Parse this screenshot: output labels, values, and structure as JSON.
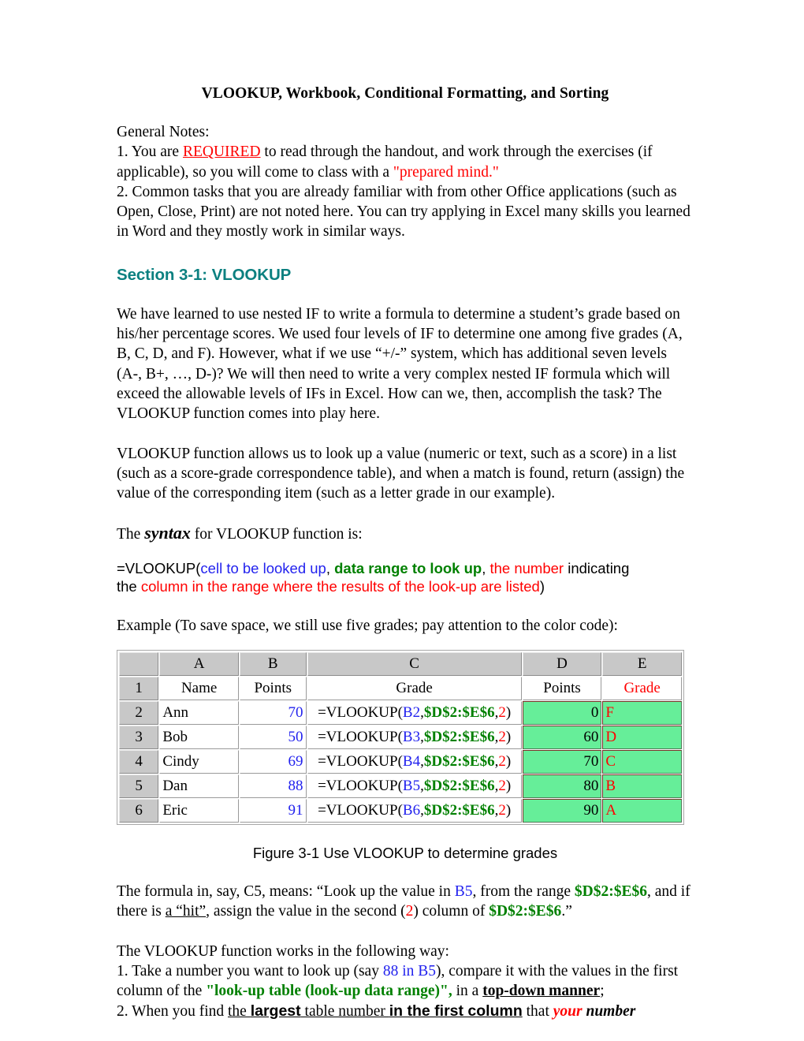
{
  "document": {
    "title": "VLOOKUP, Workbook, Conditional Formatting, and Sorting"
  },
  "general_notes": {
    "label": "General Notes:",
    "item1": {
      "lead": "1. You are ",
      "required": "REQUIRED",
      "mid": " to read through the handout, and work through the exercises (if applicable), so you will come to class with a ",
      "quote": "\"prepared mind.\""
    },
    "item2": "2. Common tasks that you are already familiar with from other Office applications (such as Open, Close, Print) are not noted here. You can try applying in Excel many skills you learned in Word and they mostly work in similar ways."
  },
  "section": {
    "heading": "Section 3-1: VLOOKUP",
    "heading_color": "#0c8080",
    "para1": "We have learned to use nested IF to write a formula to determine a student’s grade based on his/her percentage scores. We used four levels of IF to determine one among five grades (A, B, C, D, and F). However, what if we use “+/-” system, which has additional seven levels (A-, B+, …, D-)? We will then need to write a very complex nested IF formula which will exceed the allowable levels of IFs in Excel. How can we, then, accomplish the task? The VLOOKUP function comes into play here.",
    "para2": "VLOOKUP function allows us to look up a value (numeric or text, such as a score) in a list (such as a score-grade correspondence table), and when a match is found, return (assign) the value of the corresponding item (such as a letter grade in our example).",
    "syntax_intro": {
      "before": "The ",
      "word": "syntax",
      "after": " for VLOOKUP function is:"
    }
  },
  "syntax": {
    "p1_black": "=VLOOKUP(",
    "p1_blue": "cell to be looked up",
    "p1_sep1": ", ",
    "p1_green": "data range to look up",
    "p1_sep2": ", ",
    "p1_red": "the number",
    "p1_black2": " indicating",
    "p2_black": "the ",
    "p2_red": "column in the range where the results of the look-up are listed",
    "p2_close": ")"
  },
  "example_intro": "Example (To save space, we still use five grades; pay attention to the color code):",
  "spreadsheet": {
    "column_headers": [
      "",
      "A",
      "B",
      "C",
      "D",
      "E"
    ],
    "row_numbers": [
      "1",
      "2",
      "3",
      "4",
      "5",
      "6"
    ],
    "row1": {
      "A": "Name",
      "B": "Points",
      "C": "Grade",
      "D": "Points",
      "E": "Grade"
    },
    "rows": [
      {
        "n": "2",
        "name": "Ann",
        "points": "70",
        "formula_pre": "=VLOOKUP(",
        "formula_cell": "B2",
        "formula_comma1": ",",
        "formula_range": "$D$2:$E$6",
        "formula_comma2": ",",
        "formula_index": "2",
        "formula_post": ")",
        "table_points": "0",
        "table_grade": "F"
      },
      {
        "n": "3",
        "name": "Bob",
        "points": "50",
        "formula_pre": "=VLOOKUP(",
        "formula_cell": "B3",
        "formula_comma1": ",",
        "formula_range": "$D$2:$E$6",
        "formula_comma2": ",",
        "formula_index": "2",
        "formula_post": ")",
        "table_points": "60",
        "table_grade": "D"
      },
      {
        "n": "4",
        "name": "Cindy",
        "points": "69",
        "formula_pre": "=VLOOKUP(",
        "formula_cell": "B4",
        "formula_comma1": ",",
        "formula_range": "$D$2:$E$6",
        "formula_comma2": ",",
        "formula_index": "2",
        "formula_post": ")",
        "table_points": "70",
        "table_grade": "C"
      },
      {
        "n": "5",
        "name": "Dan",
        "points": "88",
        "formula_pre": "=VLOOKUP(",
        "formula_cell": "B5",
        "formula_comma1": ",",
        "formula_range": "$D$2:$E$6",
        "formula_comma2": ",",
        "formula_index": "2",
        "formula_post": ")",
        "table_points": "80",
        "table_grade": "B"
      },
      {
        "n": "6",
        "name": "Eric",
        "points": "91",
        "formula_pre": "=VLOOKUP(",
        "formula_cell": "B6",
        "formula_comma1": ",",
        "formula_range": "$D$2:$E$6",
        "formula_comma2": ",",
        "formula_index": "2",
        "formula_post": ")",
        "table_points": "90",
        "table_grade": "A"
      }
    ],
    "colors": {
      "header_fill": "#c8c8c8",
      "lookup_range_fill": "#66ee99",
      "lookup_range_border": "#7a3028",
      "input_value": "#2222ee",
      "grade_value": "#ff0000",
      "range_ref": "#008000"
    }
  },
  "figure": {
    "caption": "Figure 3-1 Use VLOOKUP to determine grades"
  },
  "explanation": {
    "p1_a": "The formula in, say, C5, means: “Look up the value in ",
    "p1_b5": "B5",
    "p1_b": ", from the range ",
    "p1_range1": "$D$2:$E$6",
    "p1_c": ", and if there is ",
    "p1_hit": "a “hit”",
    "p1_d": ", assign the value in the second (",
    "p1_two": "2",
    "p1_e": ") column of ",
    "p1_range2": "$D$2:$E$6",
    "p1_f": ".”"
  },
  "how_it_works": {
    "lead": "The VLOOKUP function works in the following way:",
    "step1_a": "1. Take a number you want to look up (say ",
    "step1_blue": "88 in B5",
    "step1_b": "), compare it with the values in the first column of the ",
    "step1_green": "\"look-up table (look-up data range)\",",
    "step1_c": " in a ",
    "step1_bold_u": "top-down manner",
    "step1_d": ";",
    "step2_a": "2. When you find ",
    "step2_the": "the ",
    "step2_largest": "largest",
    "step2_b": " table number ",
    "step2_col": "in the first column",
    "step2_c": " that ",
    "step2_your": "your",
    "step2_number": " number"
  }
}
